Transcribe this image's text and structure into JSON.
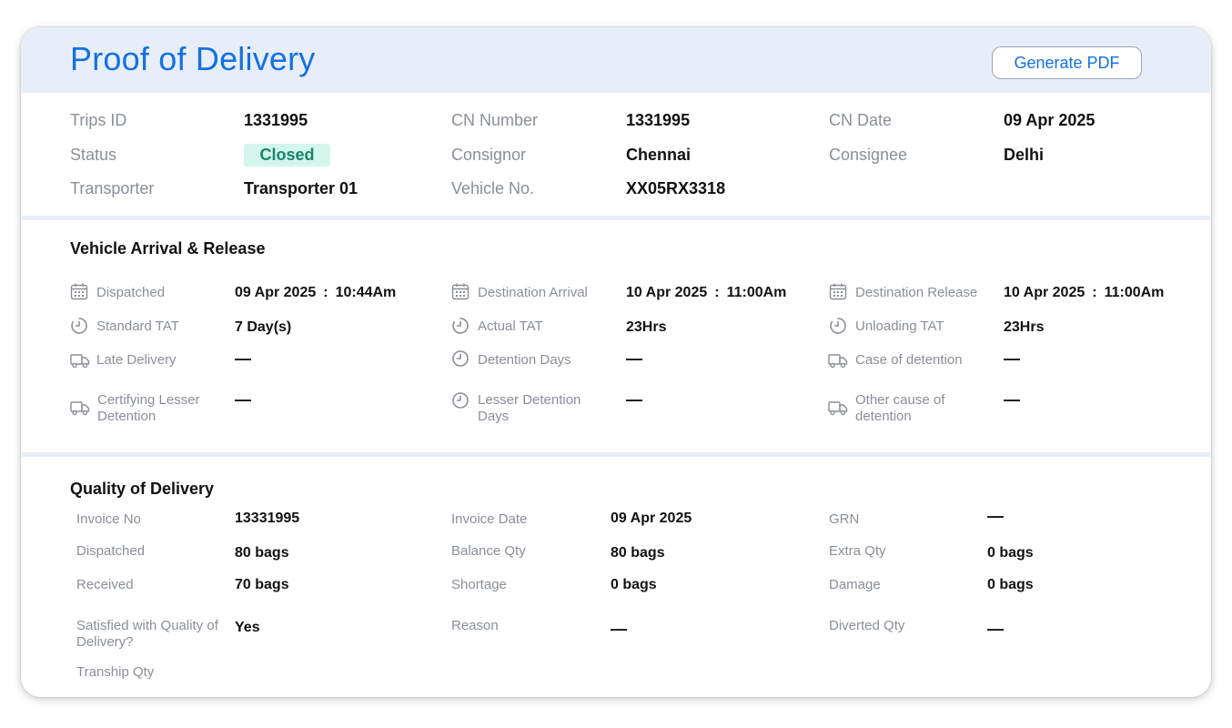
{
  "header": {
    "title": "Proof of Delivery",
    "generate_pdf": "Generate PDF"
  },
  "trip": {
    "trips_id_label": "Trips ID",
    "trips_id": "1331995",
    "cn_number_label": "CN Number",
    "cn_number": "1331995",
    "cn_date_label": "CN Date",
    "cn_date": "09 Apr 2025",
    "status_label": "Status",
    "status": "Closed",
    "consignor_label": "Consignor",
    "consignor": "Chennai",
    "consignee_label": "Consignee",
    "consignee": "Delhi",
    "transporter_label": "Transporter",
    "transporter": "Transporter 01",
    "vehicle_label": "Vehicle No.",
    "vehicle": "XX05RX3318"
  },
  "arrival": {
    "title": "Vehicle Arrival & Release",
    "dispatched_label": "Dispatched",
    "dispatched_date": "09 Apr 2025",
    "dispatched_time": "10:44Am",
    "dest_arrival_label": "Destination Arrival",
    "dest_arrival_date": "10 Apr 2025",
    "dest_arrival_time": "11:00Am",
    "dest_release_label": "Destination Release",
    "dest_release_date": "10 Apr 2025",
    "dest_release_time": "11:00Am",
    "separator": ":",
    "standard_tat_label": "Standard TAT",
    "standard_tat": "7 Day(s)",
    "actual_tat_label": "Actual TAT",
    "actual_tat": "23Hrs",
    "unloading_tat_label": "Unloading TAT",
    "unloading_tat": "23Hrs",
    "late_delivery_label": "Late Delivery",
    "late_delivery": "—",
    "detention_days_label": "Detention Days",
    "detention_days": "—",
    "case_detention_label": "Case of detention",
    "case_detention": "—",
    "cert_lesser_label": "Certifying Lesser Detention",
    "cert_lesser": "—",
    "lesser_days_label": "Lesser Detention Days",
    "lesser_days": "—",
    "other_cause_label": "Other cause of detention",
    "other_cause": "—"
  },
  "quality": {
    "title": "Quality of Delivery",
    "invoice_no_label": "Invoice No",
    "invoice_no": "13331995",
    "invoice_date_label": "Invoice Date",
    "invoice_date": "09 Apr 2025",
    "grn_label": "GRN",
    "grn": "—",
    "dispatched_label": "Dispatched",
    "dispatched": "80 bags",
    "balance_label": "Balance Qty",
    "balance": "80 bags",
    "extra_label": "Extra Qty",
    "extra": "0 bags",
    "received_label": "Received",
    "received": "70 bags",
    "shortage_label": "Shortage",
    "shortage": "0 bags",
    "damage_label": "Damage",
    "damage": "0 bags",
    "satisfied_label": "Satisfied with Quality of Delivery?",
    "satisfied": "Yes",
    "reason_label": "Reason",
    "reason": "—",
    "diverted_label": "Diverted Qty",
    "diverted": "—",
    "tranship_label": "Tranship Qty"
  }
}
